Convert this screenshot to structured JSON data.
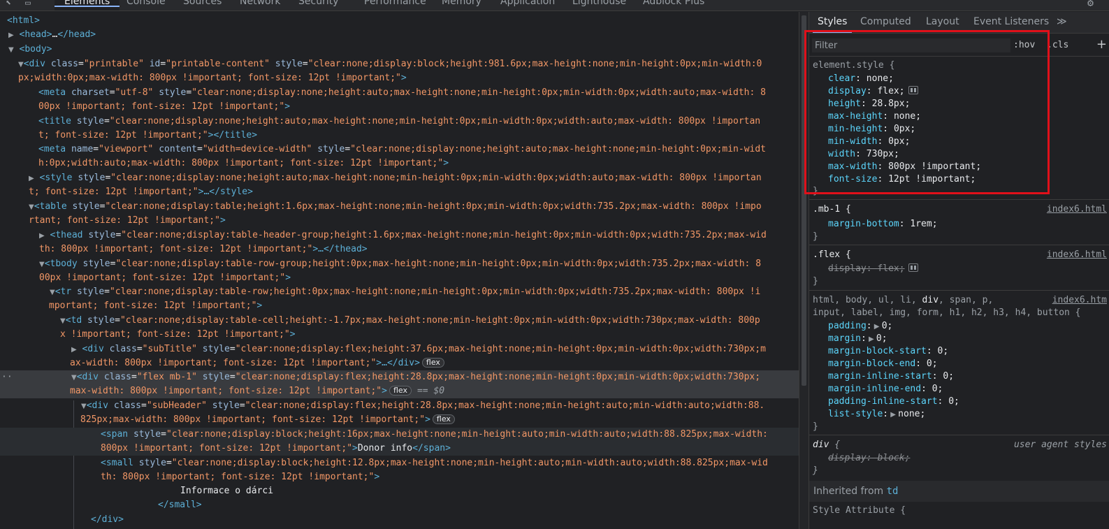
{
  "toolbar": {
    "tabs": [
      "Elements",
      "Console",
      "Sources",
      "Network",
      "Security",
      "Performance",
      "Memory",
      "Application",
      "Lighthouse",
      "Adblock Plus"
    ],
    "active_tab": "Elements"
  },
  "dom": {
    "l01": "<html>",
    "l02a": "<head>",
    "l02b": "…",
    "l02c": "</head>",
    "l03": "<body>",
    "l04_tag": "<div",
    "l04_a1": " class",
    "l04_v1": "\"printable\"",
    "l04_a2": " id",
    "l04_v2": "\"printable-content\"",
    "l04_a3": " style",
    "l04_v3a": "\"clear:none;display:block;height:981.6px;max-height:none;min-height:0px;min-width:0",
    "l04_v3b": "px;width:0px;max-width: 800px !important; font-size: 12pt !important;\"",
    "l04_end": ">",
    "l05_tag": "<meta",
    "l05_a1": " charset",
    "l05_v1": "\"utf-8\"",
    "l05_a2": " style",
    "l05_v2a": "\"clear:none;display:none;height:auto;max-height:none;min-height:0px;min-width:0px;width:auto;max-width: 8",
    "l05_v2b": "00px !important; font-size: 12pt !important;\"",
    "l05_end": ">",
    "l06_tag": "<title",
    "l06_a1": " style",
    "l06_v1a": "\"clear:none;display:none;height:auto;max-height:none;min-height:0px;min-width:0px;width:auto;max-width: 800px !importan",
    "l06_v1b": "t; font-size: 12pt !important;\"",
    "l06_end": "></title>",
    "l07_tag": "<meta",
    "l07_a1": " name",
    "l07_v1": "\"viewport\"",
    "l07_a2": " content",
    "l07_v2": "\"width=device-width\"",
    "l07_a3": " style",
    "l07_v3a": "\"clear:none;display:none;height:auto;max-height:none;min-height:0px;min-widt",
    "l07_v3b": "h:0px;width:auto;max-width: 800px !important; font-size: 12pt !important;\"",
    "l07_end": ">",
    "l08_tag": "<style",
    "l08_a1": " style",
    "l08_v1a": "\"clear:none;display:none;height:auto;max-height:none;min-height:0px;min-width:0px;width:auto;max-width: 800px !importan",
    "l08_v1b": "t; font-size: 12pt !important;\"",
    "l08_end": ">…</style>",
    "l09_tag": "<table",
    "l09_a1": " style",
    "l09_v1a": "\"clear:none;display:table;height:1.6px;max-height:none;min-height:0px;min-width:0px;width:735.2px;max-width: 800px !impo",
    "l09_v1b": "rtant; font-size: 12pt !important;\"",
    "l09_end": ">",
    "l10_tag": "<thead",
    "l10_a1": " style",
    "l10_v1a": "\"clear:none;display:table-header-group;height:1.6px;max-height:none;min-height:0px;min-width:0px;width:735.2px;max-wid",
    "l10_v1b": "th: 800px !important; font-size: 12pt !important;\"",
    "l10_end": ">…</thead>",
    "l11_tag": "<tbody",
    "l11_a1": " style",
    "l11_v1a": "\"clear:none;display:table-row-group;height:0px;max-height:none;min-height:0px;min-width:0px;width:735.2px;max-width: 8",
    "l11_v1b": "00px !important; font-size: 12pt !important;\"",
    "l11_end": ">",
    "l12_tag": "<tr",
    "l12_a1": " style",
    "l12_v1a": "\"clear:none;display:table-row;height:0px;max-height:none;min-height:0px;min-width:0px;width:735.2px;max-width: 800px !i",
    "l12_v1b": "mportant; font-size: 12pt !important;\"",
    "l12_end": ">",
    "l13_tag": "<td",
    "l13_a1": " style",
    "l13_v1a": "\"clear:none;display:table-cell;height:-1.7px;max-height:none;min-height:0px;min-width:0px;width:730px;max-width: 800p",
    "l13_v1b": "x !important; font-size: 12pt !important;\"",
    "l13_end": ">",
    "l14_tag": "<div",
    "l14_a1": " class",
    "l14_v1": "\"subTitle\"",
    "l14_a2": " style",
    "l14_v2a": "\"clear:none;display:flex;height:37.6px;max-height:none;min-height:0px;min-width:0px;width:730px;m",
    "l14_v2b": "ax-width: 800px !important; font-size: 12pt !important;\"",
    "l14_end": ">…</div>",
    "l14_badge": "flex",
    "l15_tag": "<div",
    "l15_a1": " class",
    "l15_v1": "\"flex mb-1\"",
    "l15_a2": " style",
    "l15_v2a": "\"clear:none;display:flex;height:28.8px;max-height:none;min-height:0px;min-width:0px;width:730px;",
    "l15_v2b": "max-width: 800px !important; font-size: 12pt !important;\"",
    "l15_end": ">",
    "l15_badge": "flex",
    "l15_eq": "== $0",
    "l16_tag": "<div",
    "l16_a1": " class",
    "l16_v1": "\"subHeader\"",
    "l16_a2": " style",
    "l16_v2a": "\"clear:none;display:flex;height:28.8px;max-height:none;min-height:auto;min-width:auto;width:88.",
    "l16_v2b": "825px;max-width: 800px !important; font-size: 12pt !important;\"",
    "l16_end": ">",
    "l16_badge": "flex",
    "l17_tag": "<span",
    "l17_a1": " style",
    "l17_v1a": "\"clear:none;display:block;height:16px;max-height:none;min-height:auto;min-width:auto;width:88.825px;max-width:",
    "l17_v1b": "800px !important; font-size: 12pt !important;\"",
    "l17_end": ">",
    "l17_text": "Donor info",
    "l17_close": "</span>",
    "l18_tag": "<small",
    "l18_a1": " style",
    "l18_v1a": "\"clear:none;display:block;height:12.8px;max-height:none;min-height:auto;min-width:auto;width:88.825px;max-wid",
    "l18_v1b": "th: 800px !important; font-size: 12pt !important;\"",
    "l18_end": ">",
    "l19_text": "Informace o dárci",
    "l20": "</small>",
    "l21": "</div>",
    "ellipsis": "··"
  },
  "styles_panel": {
    "tabs": [
      "Styles",
      "Computed",
      "Layout",
      "Event Listeners"
    ],
    "more": "≫",
    "filter_placeholder": "Filter",
    "hov": ":hov",
    "cls": ".cls",
    "plus": "+",
    "element_style": {
      "selector": "element.style {",
      "props": [
        [
          "clear",
          "none"
        ],
        [
          "display",
          "flex"
        ],
        [
          "height",
          "28.8px"
        ],
        [
          "max-height",
          "none"
        ],
        [
          "min-height",
          "0px"
        ],
        [
          "min-width",
          "0px"
        ],
        [
          "width",
          "730px"
        ],
        [
          "max-width",
          "800px !important"
        ],
        [
          "font-size",
          "12pt !important"
        ]
      ],
      "close": "}"
    },
    "mb1": {
      "selector": ".mb-1 {",
      "source": "index6.html",
      "prop": "margin-bottom",
      "value": "1rem",
      "close": "}"
    },
    "flex": {
      "selector": ".flex {",
      "source": "index6.html",
      "prop": "display",
      "value": "flex",
      "close": "}"
    },
    "reset": {
      "sel1a": "html, body, ul, li, ",
      "sel1b": "div",
      "sel1c": ", span, p,",
      "sel2": "input, label, img, form, h1, h2, h3, h4, button {",
      "source": "index6.htm",
      "props": [
        [
          "padding",
          "0"
        ],
        [
          "margin",
          "0"
        ],
        [
          "margin-block-start",
          "0"
        ],
        [
          "margin-block-end",
          "0"
        ],
        [
          "margin-inline-start",
          "0"
        ],
        [
          "margin-inline-end",
          "0"
        ],
        [
          "padding-inline-start",
          "0"
        ],
        [
          "list-style",
          "none"
        ]
      ],
      "close": "}"
    },
    "ua": {
      "selector": "div",
      "brace": " {",
      "source": "user agent styles",
      "prop": "display",
      "value": "block",
      "close": "}"
    },
    "inherited": {
      "label": "Inherited from ",
      "tag": "td"
    },
    "style_attr": "Style Attribute {"
  },
  "colors": {
    "highlight_box": "#e0101a",
    "accent": "#8ab4f8"
  }
}
